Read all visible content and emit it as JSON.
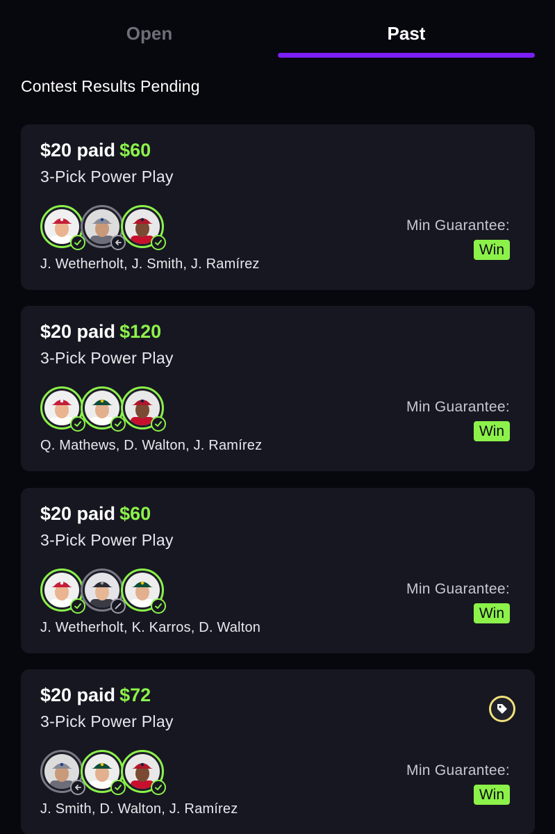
{
  "tabs": {
    "open_label": "Open",
    "past_label": "Past",
    "active": "Past"
  },
  "section_title": "Contest Results Pending",
  "colors": {
    "accent": "#7b1ff5",
    "win_green": "#8cf24a",
    "card_bg": "#171721",
    "tag_yellow": "#f2e27a"
  },
  "cards": [
    {
      "paid_label": "$20 paid",
      "payout": "$60",
      "subtitle": "3-Pick Power Play",
      "picks": [
        {
          "team": "cardinals",
          "status": "hit"
        },
        {
          "team": "royals",
          "status": "returned"
        },
        {
          "team": "guardians",
          "status": "hit"
        }
      ],
      "players": "J. Wetherholt, J. Smith, J. Ramírez",
      "guarantee_label": "Min Guarantee:",
      "guarantee_value": "Win",
      "has_tag": false
    },
    {
      "paid_label": "$20 paid",
      "payout": "$120",
      "subtitle": "3-Pick Power Play",
      "picks": [
        {
          "team": "cardinals",
          "status": "hit"
        },
        {
          "team": "athletics",
          "status": "hit"
        },
        {
          "team": "guardians",
          "status": "hit"
        }
      ],
      "players": "Q. Mathews, D. Walton, J. Ramírez",
      "guarantee_label": "Min Guarantee:",
      "guarantee_value": "Win",
      "has_tag": false
    },
    {
      "paid_label": "$20 paid",
      "payout": "$60",
      "subtitle": "3-Pick Power Play",
      "picks": [
        {
          "team": "cardinals",
          "status": "hit"
        },
        {
          "team": "rockies",
          "status": "void"
        },
        {
          "team": "athletics",
          "status": "hit"
        }
      ],
      "players": "J. Wetherholt, K. Karros, D. Walton",
      "guarantee_label": "Min Guarantee:",
      "guarantee_value": "Win",
      "has_tag": false
    },
    {
      "paid_label": "$20 paid",
      "payout": "$72",
      "subtitle": "3-Pick Power Play",
      "picks": [
        {
          "team": "royals",
          "status": "returned"
        },
        {
          "team": "athletics",
          "status": "hit"
        },
        {
          "team": "guardians",
          "status": "hit"
        }
      ],
      "players": "J. Smith, D. Walton, J. Ramírez",
      "guarantee_label": "Min Guarantee:",
      "guarantee_value": "Win",
      "has_tag": true,
      "tag_icon": "price-tag-icon"
    }
  ]
}
